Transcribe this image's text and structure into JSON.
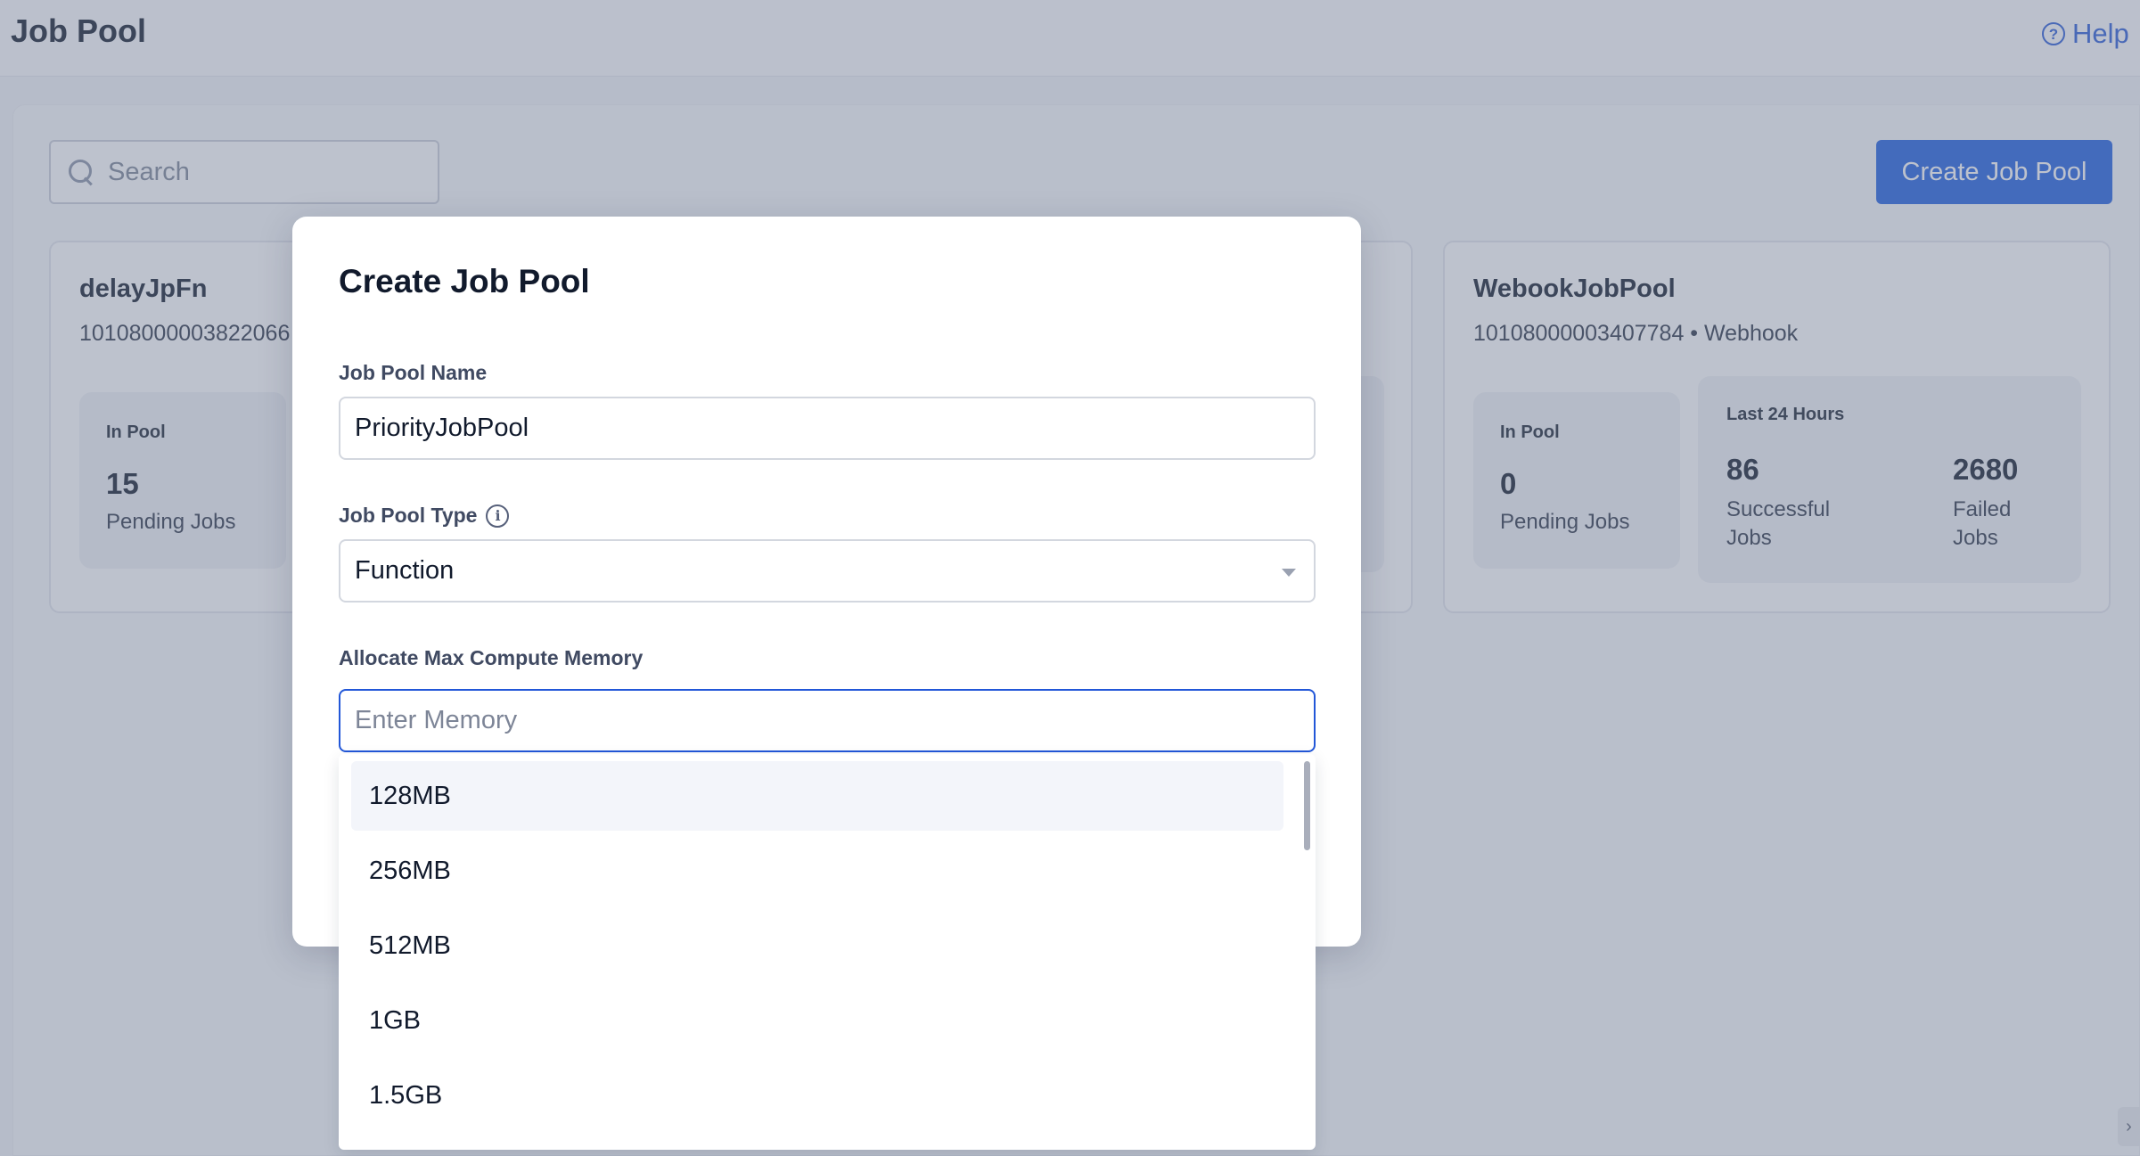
{
  "header": {
    "title": "Job Pool",
    "help_label": "Help"
  },
  "search": {
    "placeholder": "Search",
    "value": ""
  },
  "toolbar": {
    "create_label": "Create Job Pool"
  },
  "cards": [
    {
      "name": "delayJpFn",
      "subtitle": "10108000003822066",
      "in_pool_label": "In Pool",
      "pending_count": "15",
      "pending_label": "Pending Jobs"
    },
    {
      "name": "WebookJobPool",
      "subtitle": "10108000003407784 • Webhook",
      "in_pool_label": "In Pool",
      "pending_count": "0",
      "pending_label": "Pending Jobs",
      "last24_label": "Last 24 Hours",
      "successful_count": "86",
      "successful_label": "Successful Jobs",
      "failed_count": "2680",
      "failed_label": "Failed Jobs"
    }
  ],
  "modal": {
    "title": "Create Job Pool",
    "name_label": "Job Pool Name",
    "name_value": "PriorityJobPool",
    "type_label": "Job Pool Type",
    "type_value": "Function",
    "memory_label": "Allocate Max Compute Memory",
    "memory_placeholder": "Enter Memory",
    "memory_value": ""
  },
  "memory_options": [
    "128MB",
    "256MB",
    "512MB",
    "1GB",
    "1.5GB"
  ],
  "icons": {
    "search": "search-icon",
    "help": "help-circle-icon",
    "info": "info-icon",
    "caret": "caret-down-icon",
    "expand": "chevron-right-icon"
  },
  "colors": {
    "accent": "#1f5ee0",
    "focus_border": "#2257d8",
    "overlay": "#707a92"
  }
}
